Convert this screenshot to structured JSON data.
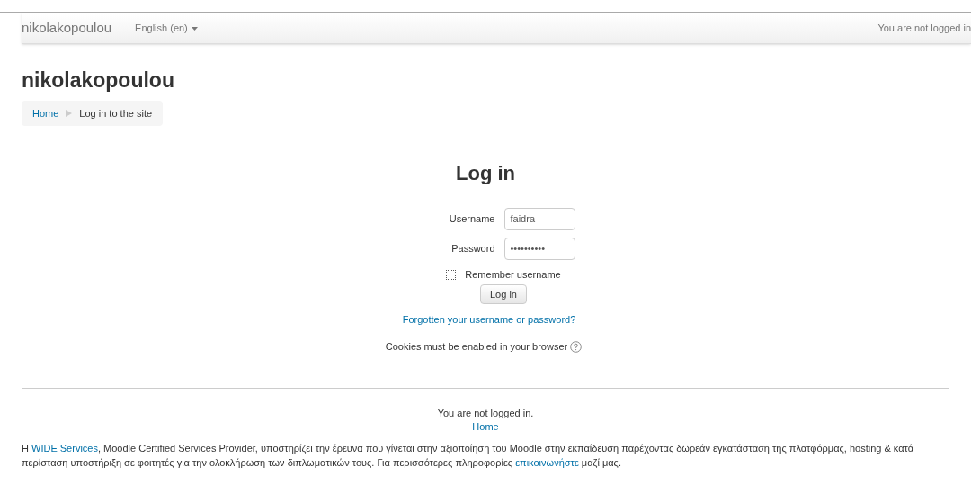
{
  "navbar": {
    "brand": "nikolakopoulou",
    "language": "English (en)",
    "login_status": "You are not logged in"
  },
  "page_title": "nikolakopoulou",
  "breadcrumb": [
    {
      "label": "Home",
      "kind": "link"
    },
    {
      "label": "Log in to the site",
      "kind": "text"
    }
  ],
  "login": {
    "heading": "Log in",
    "fields": [
      {
        "label": "Username",
        "value": "faidra"
      },
      {
        "label": "Password",
        "value": "••••••••••"
      }
    ],
    "remember": {
      "label": "Remember username",
      "checked": false
    },
    "button": "Log in",
    "forgot_link": "Forgotten your username or password?",
    "cookies_note": "Cookies must be enabled in your browser"
  },
  "footer": {
    "login_info": "You are not logged in.",
    "home_link": "Home",
    "note": [
      {
        "kind": "text",
        "text": "Η "
      },
      {
        "kind": "link",
        "text": "WIDE Services"
      },
      {
        "kind": "text",
        "text": ", Moodle Certified Services Provider, υποστηρίζει την έρευνα που γίνεται στην αξιοποίηση του Moodle στην εκπαίδευση παρέχοντας δωρεάν εγκατάσταση της πλατφόρμας, hosting & κατά περίσταση υποστήριξη σε φοιτητές για την ολοκλήρωση των διπλωματικών τους. Για περισσότερες πληροφορίες "
      },
      {
        "kind": "link",
        "text": "επικοινωνήστε"
      },
      {
        "kind": "text",
        "text": " μαζί μας."
      }
    ]
  }
}
